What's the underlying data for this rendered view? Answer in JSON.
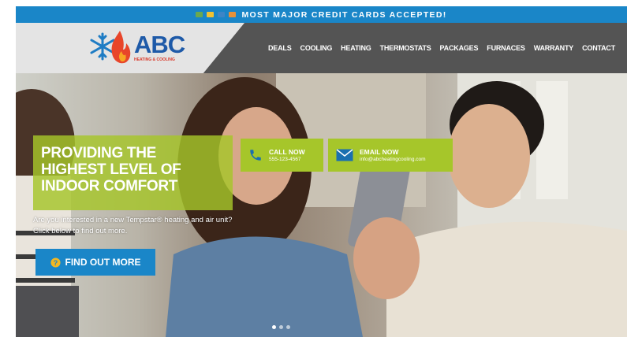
{
  "topbar": {
    "text": "MOST MAJOR CREDIT CARDS ACCEPTED!",
    "card_colors": [
      "#6aa84f",
      "#f1c232",
      "#3d85c6",
      "#e69138"
    ]
  },
  "logo": {
    "name": "ABC",
    "tagline": "HEATING & COOLING"
  },
  "nav": {
    "items": [
      "DEALS",
      "COOLING",
      "HEATING",
      "THERMOSTATS",
      "PACKAGES",
      "FURNACES",
      "WARRANTY",
      "CONTACT"
    ]
  },
  "contact": {
    "call": {
      "title": "CALL NOW",
      "value": "555-123-4567"
    },
    "email": {
      "title": "EMAIL NOW",
      "value": "info@abcheatingcooling.com"
    }
  },
  "hero": {
    "title": "PROVIDING THE HIGHEST LEVEL OF INDOOR COMFORT",
    "text": "Are you interested in a new Tempstar® heating and air unit? Click below to find out more.",
    "button_label": "FIND OUT MORE",
    "slides_total": 3,
    "active_slide": 1
  },
  "colors": {
    "blue": "#1a86c8",
    "green": "#a6c62a",
    "header": "#545454",
    "logo_red": "#e8452a"
  }
}
